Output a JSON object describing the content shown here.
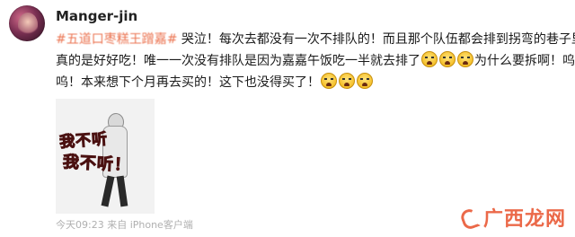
{
  "post": {
    "username": "Manger-jin",
    "lines": {
      "l1_topic": "#五道口枣糕王蹭嘉#",
      "l1_rest": " 哭泣！每次去都没有一次不排队的！而且那个队伍都会排到拐弯的巷子里！",
      "l2_start": "真的是好好吃！唯一一次没有排队是因为嘉嘉午饭吃一半就去排了",
      "l2_end": "为什么要拆啊！呜呜",
      "l3": "呜！本来想下个月再去买的！这下也没得买了！"
    },
    "emoji_name": "crying-face-emoji",
    "sticker": {
      "text_1": "我不听",
      "text_2": "我不听！"
    },
    "footer": "今天09:23 来自 iPhone客户端"
  },
  "watermark": {
    "text": "广西龙网"
  },
  "colors": {
    "topic": "#eb7350",
    "text": "#1a1a1a",
    "meta": "#b0b0b0",
    "watermark": "#e8502a",
    "sticker_text": "#e63a2e"
  }
}
